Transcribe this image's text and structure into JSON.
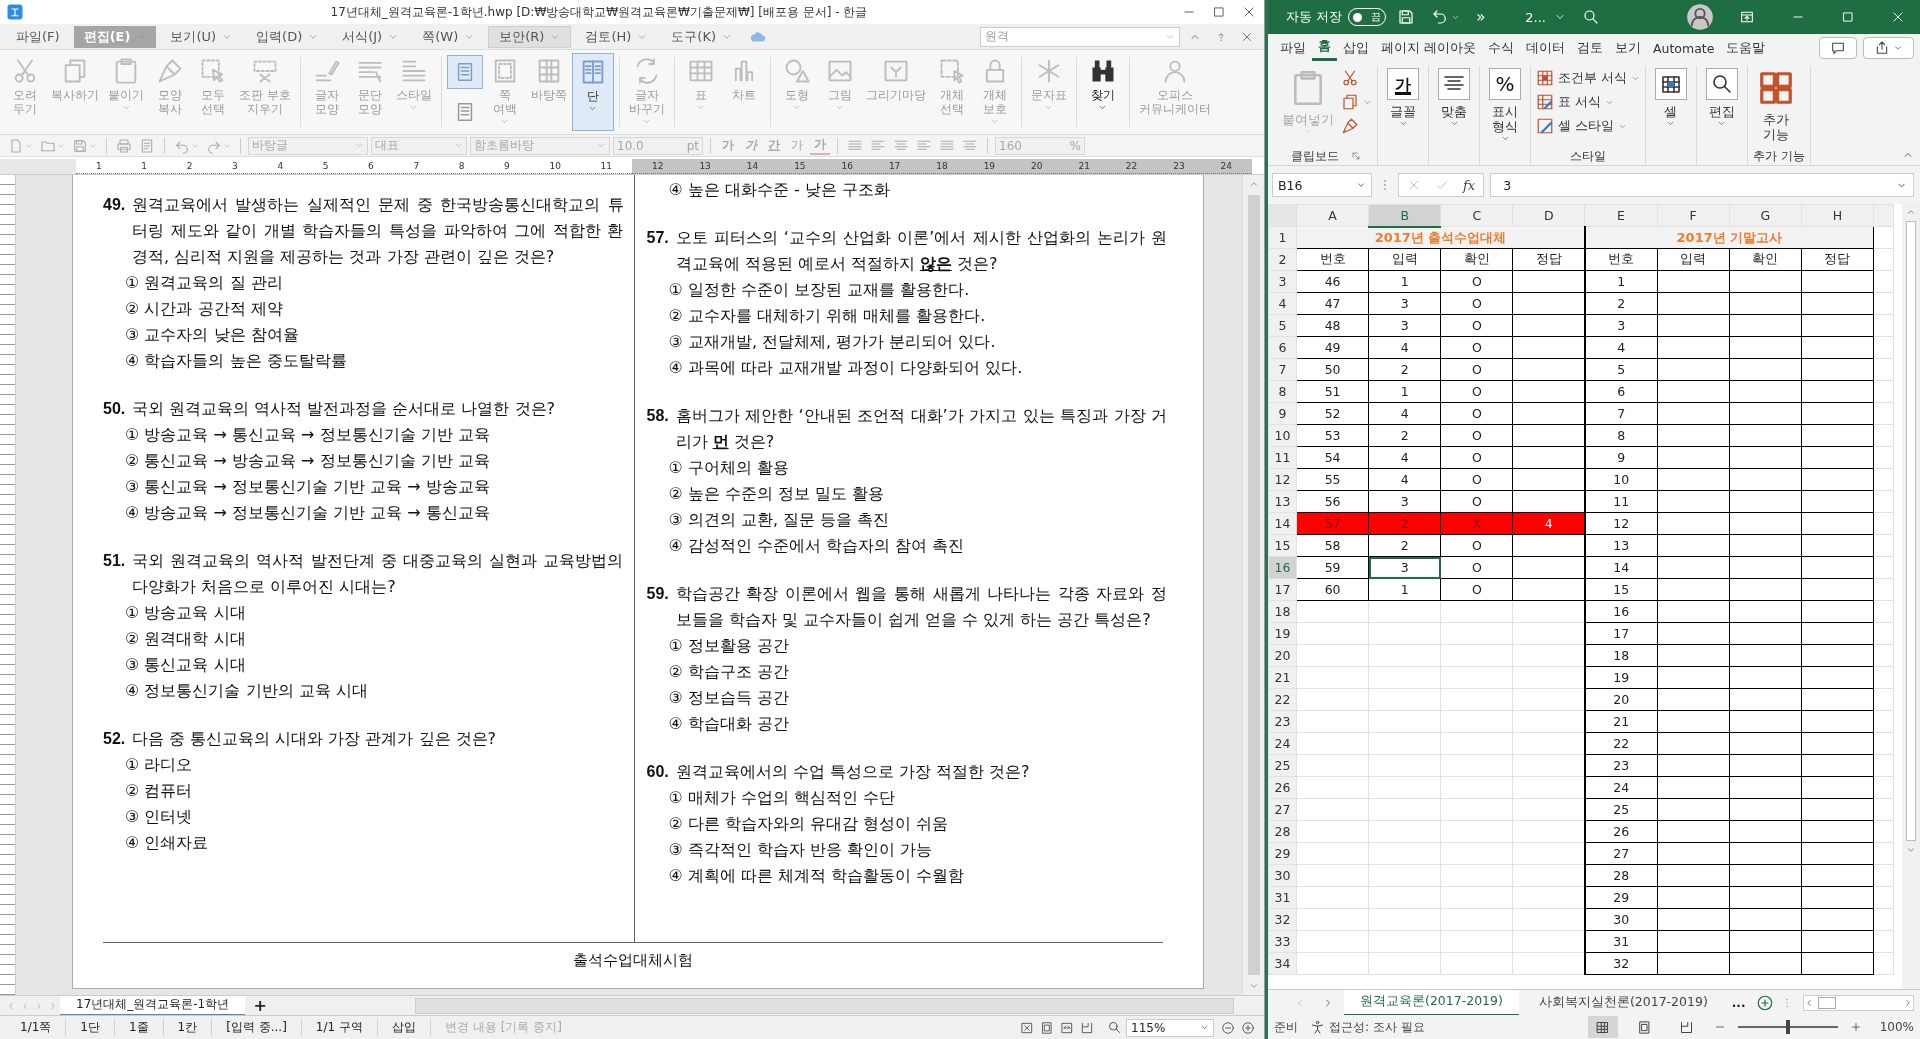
{
  "hwp": {
    "title": "17년대체_원격교육론-1학년.hwp [D:₩방송대학교₩원격교육론₩기출문제₩] [배포용 문서] - 한글",
    "menus": [
      {
        "label": "파일(F)",
        "selected": false,
        "dropdown": false
      },
      {
        "label": "편집(E)",
        "selected": true,
        "dropdown": true
      },
      {
        "label": "보기(U)",
        "selected": false,
        "dropdown": true
      },
      {
        "label": "입력(D)",
        "selected": false,
        "dropdown": true
      },
      {
        "label": "서식(J)",
        "selected": false,
        "dropdown": true
      },
      {
        "label": "쪽(W)",
        "selected": false,
        "dropdown": true
      },
      {
        "label": "보안(R)",
        "selected": false,
        "dropdown": true,
        "hovered": true
      },
      {
        "label": "검토(H)",
        "selected": false,
        "dropdown": true
      },
      {
        "label": "도구(K)",
        "selected": false,
        "dropdown": true
      }
    ],
    "search": {
      "value": "원격"
    },
    "ribbon": [
      {
        "kind": "cut",
        "lines": [
          "오려",
          "두기"
        ],
        "disabled": true,
        "dropdown": false,
        "selected": false
      },
      {
        "kind": "copy",
        "lines": [
          "복사하기"
        ],
        "disabled": true,
        "dropdown": false,
        "selected": false
      },
      {
        "kind": "paste",
        "lines": [
          "붙이기"
        ],
        "disabled": true,
        "dropdown": true,
        "selected": false
      },
      {
        "kind": "format-copy",
        "lines": [
          "모양",
          "복사"
        ],
        "disabled": true,
        "dropdown": false,
        "selected": false
      },
      {
        "kind": "select-all",
        "lines": [
          "모두",
          "선택"
        ],
        "disabled": true,
        "dropdown": false,
        "selected": false
      },
      {
        "kind": "clear-codes",
        "lines": [
          "조판 부호",
          "지우기"
        ],
        "disabled": true,
        "dropdown": false,
        "selected": false
      },
      {
        "kind": "separator"
      },
      {
        "kind": "char-shape",
        "lines": [
          "글자",
          "모양"
        ],
        "disabled": true,
        "dropdown": false,
        "selected": false
      },
      {
        "kind": "para-shape",
        "lines": [
          "문단",
          "모양"
        ],
        "disabled": true,
        "dropdown": false,
        "selected": false
      },
      {
        "kind": "style",
        "lines": [
          "스타일"
        ],
        "disabled": true,
        "dropdown": true,
        "selected": false
      },
      {
        "kind": "separator"
      },
      {
        "kind": "views",
        "views": [
          {
            "selected": true
          },
          {
            "selected": false
          }
        ]
      },
      {
        "kind": "margin",
        "lines": [
          "쪽",
          "여백"
        ],
        "disabled": true,
        "dropdown": true,
        "selected": false
      },
      {
        "kind": "master-page",
        "lines": [
          "바탕쪽"
        ],
        "disabled": true,
        "dropdown": false,
        "selected": false
      },
      {
        "kind": "columns",
        "lines": [
          "단"
        ],
        "disabled": false,
        "dropdown": true,
        "selected": true
      },
      {
        "kind": "separator"
      },
      {
        "kind": "replace",
        "lines": [
          "글자",
          "바꾸기"
        ],
        "disabled": true,
        "dropdown": true,
        "selected": false
      },
      {
        "kind": "separator"
      },
      {
        "kind": "table",
        "lines": [
          "표"
        ],
        "disabled": true,
        "dropdown": true,
        "selected": false
      },
      {
        "kind": "chart",
        "lines": [
          "차트"
        ],
        "disabled": true,
        "dropdown": false,
        "selected": false
      },
      {
        "kind": "separator"
      },
      {
        "kind": "shape",
        "lines": [
          "도형"
        ],
        "disabled": true,
        "dropdown": true,
        "selected": false
      },
      {
        "kind": "picture",
        "lines": [
          "그림"
        ],
        "disabled": true,
        "dropdown": true,
        "selected": false
      },
      {
        "kind": "gallery",
        "lines": [
          "그리기마당"
        ],
        "disabled": true,
        "dropdown": false,
        "selected": false
      },
      {
        "kind": "select-object",
        "lines": [
          "개체",
          "선택"
        ],
        "disabled": true,
        "dropdown": false,
        "selected": false
      },
      {
        "kind": "protect",
        "lines": [
          "개체",
          "보호"
        ],
        "disabled": true,
        "dropdown": true,
        "selected": false
      },
      {
        "kind": "separator"
      },
      {
        "kind": "symbol",
        "lines": [
          "문자표"
        ],
        "disabled": true,
        "dropdown": true,
        "selected": false
      },
      {
        "kind": "separator"
      },
      {
        "kind": "find",
        "lines": [
          "찾기"
        ],
        "disabled": false,
        "dropdown": true,
        "selected": false
      },
      {
        "kind": "separator"
      },
      {
        "kind": "messenger",
        "lines": [
          "오피스",
          "커뮤니케이터"
        ],
        "disabled": true,
        "dropdown": false,
        "selected": false
      }
    ],
    "format_bar": {
      "disabled": true,
      "style": "바탕글",
      "lang": "대표",
      "font": "함초롬바탕",
      "size": "10.0",
      "unit": "pt",
      "char_buttons": [
        {
          "kind": "bold",
          "text": "가"
        },
        {
          "kind": "italic",
          "text": "가"
        },
        {
          "kind": "underline",
          "text": "간"
        },
        {
          "kind": "superscript",
          "text": "가"
        },
        {
          "kind": "color",
          "text": "가"
        }
      ],
      "line_spacing": "160",
      "line_unit": "%"
    },
    "ruler": {
      "active": "1 1 2 3 4 5 6 7 8 9 10 11",
      "inactive": "12 13 14 15 16 17 18 19 20 21 22 23 24"
    },
    "document": {
      "columns": [
        [
          {
            "kind": "question",
            "number": "49.",
            "text": "원격교육에서 발생하는 실제적인 문제 중 한국방송통신대학교의 튜터링 제도와 같이 개별 학습자들의 특성을 파악하여 그에 적합한 환경적, 심리적 지원을 제공하는 것과 가장 관련이 깊은 것은?",
            "options": [
              "① 원격교육의 질 관리",
              "② 시간과 공간적 제약",
              "③ 교수자의 낮은 참여율",
              "④ 학습자들의 높은 중도탈락률"
            ]
          },
          {
            "kind": "question",
            "number": "50.",
            "text": "국외 원격교육의 역사적 발전과정을 순서대로 나열한 것은?",
            "options": [
              "① 방송교육 → 통신교육 → 정보통신기술 기반 교육",
              "② 통신교육 → 방송교육 → 정보통신기술 기반 교육",
              "③ 통신교육 → 정보통신기술 기반 교육 → 방송교육",
              "④ 방송교육 → 정보통신기술 기반 교육 → 통신교육"
            ]
          },
          {
            "kind": "question",
            "number": "51.",
            "text": "국외 원격교육의 역사적 발전단계 중 대중교육의 실현과 교육방법의 다양화가 처음으로 이루어진 시대는?",
            "options": [
              "① 방송교육 시대",
              "② 원격대학 시대",
              "③ 통신교육 시대",
              "④ 정보통신기술 기반의 교육 시대"
            ]
          },
          {
            "kind": "question",
            "number": "52.",
            "text": "다음 중 통신교육의 시대와 가장 관계가 깊은 것은?",
            "options": [
              "① 라디오",
              "② 컴퓨터",
              "③ 인터넷",
              "④ 인쇄자료"
            ]
          }
        ],
        [
          {
            "kind": "options",
            "options": [
              "④ 높은 대화수준 - 낮은 구조화"
            ]
          },
          {
            "kind": "question",
            "number": "57.",
            "text": "오토 피터스의 ‘교수의 산업화 이론’에서 제시한 산업화의 논리가 원격교육에 적용된 예로서 적절하지 **않은** 것은?",
            "options": [
              "① 일정한 수준이 보장된 교재를 활용한다.",
              "② 교수자를 대체하기 위해 매체를 활용한다.",
              "③ 교재개발, 전달체제, 평가가 분리되어 있다.",
              "④ 과목에 따라 교재개발 과정이 다양화되어 있다."
            ]
          },
          {
            "kind": "question",
            "number": "58.",
            "text": "홈버그가 제안한 ‘안내된 조언적 대화’가 가지고 있는 특징과 가장 거리가 **먼** 것은?",
            "options": [
              "① 구어체의 활용",
              "② 높은 수준의 정보 밀도 활용",
              "③ 의견의 교환, 질문 등을 촉진",
              "④ 감성적인 수준에서 학습자의 참여 촉진"
            ]
          },
          {
            "kind": "question",
            "number": "59.",
            "text": "학습공간 확장 이론에서 웹을 통해 새롭게 나타나는 각종 자료와 정보들을 학습자 및 교수자들이 쉽게 얻을 수 있게 하는 공간 특성은?",
            "options": [
              "① 정보활용 공간",
              "② 학습구조 공간",
              "③ 정보습득 공간",
              "④ 학습대화 공간"
            ]
          },
          {
            "kind": "question",
            "number": "60.",
            "text": "원격교육에서의 수업 특성으로 가장 적절한 것은?",
            "options": [
              "① 매체가 수업의 핵심적인 수단",
              "② 다른 학습자와의 유대감 형성이 쉬움",
              "③ 즉각적인 학습자 반응 확인이 가능",
              "④ 계획에 따른 체계적 학습활동이 수월함"
            ]
          }
        ]
      ],
      "footer": "출석수업대체시험"
    },
    "doc_tabs": [
      {
        "label": "17년대체_원격교육론-1학년",
        "selected": true
      }
    ],
    "add_tab": "+",
    "status": [
      {
        "text": "1/1쪽",
        "disabled": false
      },
      {
        "text": "1단",
        "disabled": false
      },
      {
        "text": "1줄",
        "disabled": false
      },
      {
        "text": "1칸",
        "disabled": false
      },
      {
        "text": "[입력 중...]",
        "disabled": false
      },
      {
        "text": "1/1 구역",
        "disabled": false
      },
      {
        "text": "삽입",
        "disabled": false
      },
      {
        "text": "변경 내용 [기록 중지]",
        "disabled": true
      }
    ],
    "zoom": "115%"
  },
  "excel": {
    "autosave_label": "자동 저장",
    "autosave": {
      "on": false,
      "label": "끔"
    },
    "more": "»",
    "filename": "2...",
    "tabs": [
      {
        "label": "파일",
        "selected": false
      },
      {
        "label": "홈",
        "selected": true
      },
      {
        "label": "삽입",
        "selected": false
      },
      {
        "label": "페이지 레이아웃",
        "selected": false
      },
      {
        "label": "수식",
        "selected": false
      },
      {
        "label": "데이터",
        "selected": false
      },
      {
        "label": "검토",
        "selected": false
      },
      {
        "label": "보기",
        "selected": false
      },
      {
        "label": "Automate",
        "selected": false
      },
      {
        "label": "도움말",
        "selected": false
      }
    ],
    "ribbon": [
      {
        "label": "클립보드",
        "launcher": true,
        "items": [
          {
            "kind": "paste",
            "lines": [
              "붙여넣기"
            ],
            "dropdown": true,
            "disabled": true
          },
          {
            "kind": "cut",
            "dropdown": false,
            "disabled": false
          },
          {
            "kind": "copy",
            "dropdown": true,
            "disabled": false
          },
          {
            "kind": "painter",
            "dropdown": false,
            "disabled": false
          }
        ]
      },
      {
        "items": [
          {
            "kind": "font",
            "icon_text": "가",
            "lines": [
              "글꼴"
            ],
            "dropdown": true,
            "disabled": false
          }
        ]
      },
      {
        "items": [
          {
            "kind": "align",
            "lines": [
              "맞춤"
            ],
            "dropdown": true,
            "disabled": false
          }
        ]
      },
      {
        "items": [
          {
            "kind": "number",
            "icon_text": "%",
            "lines": [
              "표시",
              "형식"
            ],
            "dropdown": true,
            "disabled": false
          }
        ]
      },
      {
        "label": "스타일",
        "launcher": false,
        "items": [
          {
            "kind": "conditional",
            "lines": [
              "조건부 서식"
            ],
            "dropdown": true,
            "disabled": false
          },
          {
            "kind": "table-format",
            "lines": [
              "표 서식"
            ],
            "dropdown": true,
            "disabled": false
          },
          {
            "kind": "cell-style",
            "lines": [
              "셀 스타일"
            ],
            "dropdown": true,
            "disabled": false
          }
        ]
      },
      {
        "items": [
          {
            "kind": "cells",
            "lines": [
              "셀"
            ],
            "dropdown": true,
            "disabled": false
          }
        ]
      },
      {
        "items": [
          {
            "kind": "edit",
            "lines": [
              "편집"
            ],
            "dropdown": true,
            "disabled": false
          }
        ]
      },
      {
        "label": "추가 기능",
        "launcher": false,
        "items": [
          {
            "kind": "addins",
            "lines": [
              "추가",
              "기능"
            ],
            "dropdown": false,
            "disabled": false
          }
        ]
      }
    ],
    "name_box": "B16",
    "function_label": "fx",
    "formula": "3",
    "columns": [
      {
        "label": "A",
        "selected": false
      },
      {
        "label": "B",
        "selected": true
      },
      {
        "label": "C",
        "selected": false
      },
      {
        "label": "D",
        "selected": false
      },
      {
        "label": "E",
        "selected": false
      },
      {
        "label": "F",
        "selected": false
      },
      {
        "label": "G",
        "selected": false
      },
      {
        "label": "H",
        "selected": false
      }
    ],
    "rows": [
      {
        "label": "1",
        "kind": "title",
        "selected": false,
        "highlighted": false,
        "attendance_title": "2017년 출석수업대체",
        "final_title": "2017년 기말고사"
      },
      {
        "label": "2",
        "kind": "data",
        "selected": false,
        "highlighted": false,
        "attendance": [
          "번호",
          "입력",
          "확인",
          "정답"
        ],
        "final": [
          "번호",
          "입력",
          "확인",
          "정답"
        ]
      },
      {
        "label": "3",
        "kind": "data",
        "selected": false,
        "highlighted": false,
        "attendance": [
          "46",
          "1",
          "O"
        ],
        "final": [
          "1"
        ]
      },
      {
        "label": "4",
        "kind": "data",
        "selected": false,
        "highlighted": false,
        "attendance": [
          "47",
          "3",
          "O"
        ],
        "final": [
          "2"
        ]
      },
      {
        "label": "5",
        "kind": "data",
        "selected": false,
        "highlighted": false,
        "attendance": [
          "48",
          "3",
          "O"
        ],
        "final": [
          "3"
        ]
      },
      {
        "label": "6",
        "kind": "data",
        "selected": false,
        "highlighted": false,
        "attendance": [
          "49",
          "4",
          "O"
        ],
        "final": [
          "4"
        ]
      },
      {
        "label": "7",
        "kind": "data",
        "selected": false,
        "highlighted": false,
        "attendance": [
          "50",
          "2",
          "O"
        ],
        "final": [
          "5"
        ]
      },
      {
        "label": "8",
        "kind": "data",
        "selected": false,
        "highlighted": false,
        "attendance": [
          "51",
          "1",
          "O"
        ],
        "final": [
          "6"
        ]
      },
      {
        "label": "9",
        "kind": "data",
        "selected": false,
        "highlighted": false,
        "attendance": [
          "52",
          "4",
          "O"
        ],
        "final": [
          "7"
        ]
      },
      {
        "label": "10",
        "kind": "data",
        "selected": false,
        "highlighted": false,
        "attendance": [
          "53",
          "2",
          "O"
        ],
        "final": [
          "8"
        ]
      },
      {
        "label": "11",
        "kind": "data",
        "selected": false,
        "highlighted": false,
        "attendance": [
          "54",
          "4",
          "O"
        ],
        "final": [
          "9"
        ]
      },
      {
        "label": "12",
        "kind": "data",
        "selected": false,
        "highlighted": false,
        "attendance": [
          "55",
          "4",
          "O"
        ],
        "final": [
          "10"
        ]
      },
      {
        "label": "13",
        "kind": "data",
        "selected": false,
        "highlighted": false,
        "attendance": [
          "56",
          "3",
          "O"
        ],
        "final": [
          "11"
        ]
      },
      {
        "label": "14",
        "kind": "data",
        "selected": false,
        "highlighted": true,
        "attendance": [
          "57",
          "2",
          "X",
          "4"
        ],
        "final": [
          "12"
        ]
      },
      {
        "label": "15",
        "kind": "data",
        "selected": false,
        "highlighted": false,
        "attendance": [
          "58",
          "2",
          "O"
        ],
        "final": [
          "13"
        ]
      },
      {
        "label": "16",
        "kind": "data",
        "selected": true,
        "highlighted": false,
        "attendance": [
          "59",
          "3",
          "O"
        ],
        "final": [
          "14"
        ]
      },
      {
        "label": "17",
        "kind": "data",
        "selected": false,
        "highlighted": false,
        "attendance": [
          "60",
          "1",
          "O"
        ],
        "final": [
          "15"
        ]
      },
      {
        "label": "18",
        "kind": "data",
        "selected": false,
        "highlighted": false,
        "final": [
          "16"
        ]
      },
      {
        "label": "19",
        "kind": "data",
        "selected": false,
        "highlighted": false,
        "final": [
          "17"
        ]
      },
      {
        "label": "20",
        "kind": "data",
        "selected": false,
        "highlighted": false,
        "final": [
          "18"
        ]
      },
      {
        "label": "21",
        "kind": "data",
        "selected": false,
        "highlighted": false,
        "final": [
          "19"
        ]
      },
      {
        "label": "22",
        "kind": "data",
        "selected": false,
        "highlighted": false,
        "final": [
          "20"
        ]
      },
      {
        "label": "23",
        "kind": "data",
        "selected": false,
        "highlighted": false,
        "final": [
          "21"
        ]
      },
      {
        "label": "24",
        "kind": "data",
        "selected": false,
        "highlighted": false,
        "final": [
          "22"
        ]
      },
      {
        "label": "25",
        "kind": "data",
        "selected": false,
        "highlighted": false,
        "final": [
          "23"
        ]
      },
      {
        "label": "26",
        "kind": "data",
        "selected": false,
        "highlighted": false,
        "final": [
          "24"
        ]
      },
      {
        "label": "27",
        "kind": "data",
        "selected": false,
        "highlighted": false,
        "final": [
          "25"
        ]
      },
      {
        "label": "28",
        "kind": "data",
        "selected": false,
        "highlighted": false,
        "final": [
          "26"
        ]
      },
      {
        "label": "29",
        "kind": "data",
        "selected": false,
        "highlighted": false,
        "final": [
          "27"
        ]
      },
      {
        "label": "30",
        "kind": "data",
        "selected": false,
        "highlighted": false,
        "final": [
          "28"
        ]
      },
      {
        "label": "31",
        "kind": "data",
        "selected": false,
        "highlighted": false,
        "final": [
          "29"
        ]
      },
      {
        "label": "32",
        "kind": "data",
        "selected": false,
        "highlighted": false,
        "final": [
          "30"
        ]
      },
      {
        "label": "33",
        "kind": "data",
        "selected": false,
        "highlighted": false,
        "final": [
          "31"
        ]
      },
      {
        "label": "34",
        "kind": "data",
        "selected": false,
        "highlighted": false,
        "final": [
          "32"
        ]
      }
    ],
    "sheets": [
      {
        "label": "원격교육론(2017-2019)",
        "selected": true
      },
      {
        "label": "사회복지실천론(2017-2019)",
        "selected": false
      }
    ],
    "more_sheets": "...",
    "status": "준비",
    "accessibility": "접근성: 조사 필요",
    "views": [
      {
        "selected": true
      },
      {
        "selected": false
      },
      {
        "selected": false
      }
    ],
    "zoom_slider": {
      "level": 0.5
    },
    "zoom": "100%"
  }
}
